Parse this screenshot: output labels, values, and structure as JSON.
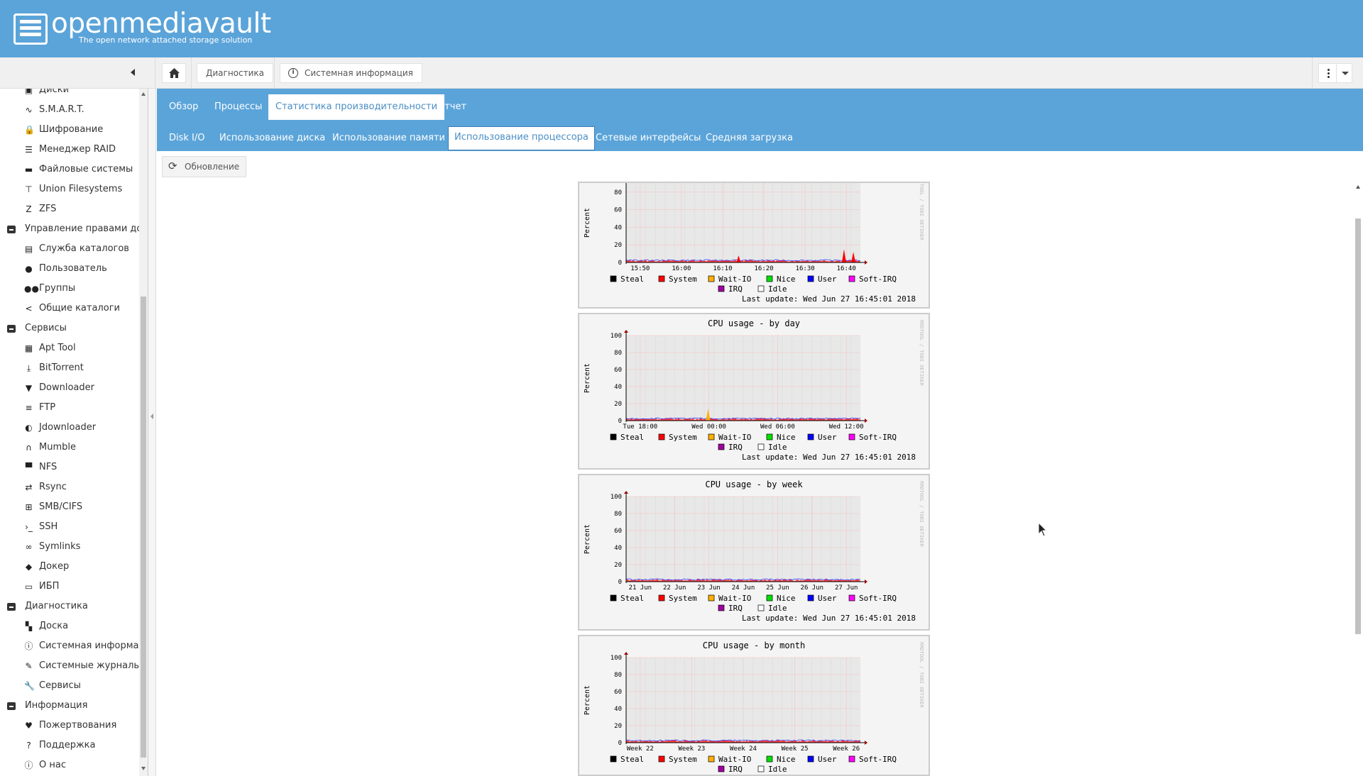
{
  "header": {
    "brand": "openmediavault",
    "tagline": "The open network attached storage solution"
  },
  "toolbar": {
    "breadcrumb": [
      "Диагностика",
      "Системная информация"
    ]
  },
  "sidebar": {
    "items": [
      {
        "type": "item",
        "icon": "disk-icon",
        "glyph": "▣",
        "label": "Диски"
      },
      {
        "type": "item",
        "icon": "heartbeat-icon",
        "glyph": "∿",
        "label": "S.M.A.R.T."
      },
      {
        "type": "item",
        "icon": "lock-icon",
        "glyph": "🔒",
        "label": "Шифрование"
      },
      {
        "type": "item",
        "icon": "database-icon",
        "glyph": "☰",
        "label": "Менеджер RAID"
      },
      {
        "type": "item",
        "icon": "folder-icon",
        "glyph": "▬",
        "label": "Файловые системы"
      },
      {
        "type": "item",
        "icon": "sitemap-icon",
        "glyph": "⊤",
        "label": "Union Filesystems"
      },
      {
        "type": "item",
        "icon": "zfs-icon",
        "glyph": "Z",
        "label": "ZFS"
      },
      {
        "type": "group",
        "label": "Управление правами доступа"
      },
      {
        "type": "item",
        "icon": "address-card-icon",
        "glyph": "▤",
        "label": "Служба каталогов"
      },
      {
        "type": "item",
        "icon": "user-icon",
        "glyph": "●",
        "label": "Пользователь"
      },
      {
        "type": "item",
        "icon": "users-icon",
        "glyph": "●●",
        "label": "Группы"
      },
      {
        "type": "item",
        "icon": "share-icon",
        "glyph": "<",
        "label": "Общие каталоги"
      },
      {
        "type": "group",
        "label": "Сервисы"
      },
      {
        "type": "item",
        "icon": "apt-icon",
        "glyph": "▦",
        "label": "Apt Tool"
      },
      {
        "type": "item",
        "icon": "download-tray-icon",
        "glyph": "⤓",
        "label": "BitTorrent"
      },
      {
        "type": "item",
        "icon": "download-box-icon",
        "glyph": "▼",
        "label": "Downloader"
      },
      {
        "type": "item",
        "icon": "server-icon",
        "glyph": "≡",
        "label": "FTP"
      },
      {
        "type": "item",
        "icon": "jdownloader-icon",
        "glyph": "◐",
        "label": "Jdownloader"
      },
      {
        "type": "item",
        "icon": "headphones-icon",
        "glyph": "∩",
        "label": "Mumble"
      },
      {
        "type": "item",
        "icon": "desktop-icon",
        "glyph": "▀",
        "label": "NFS"
      },
      {
        "type": "item",
        "icon": "rsync-icon",
        "glyph": "⇄",
        "label": "Rsync"
      },
      {
        "type": "item",
        "icon": "windows-icon",
        "glyph": "⊞",
        "label": "SMB/CIFS"
      },
      {
        "type": "item",
        "icon": "terminal-icon",
        "glyph": "›_",
        "label": "SSH"
      },
      {
        "type": "item",
        "icon": "link-icon",
        "glyph": "∞",
        "label": "Symlinks"
      },
      {
        "type": "item",
        "icon": "docker-icon",
        "glyph": "◆",
        "label": "Докер"
      },
      {
        "type": "item",
        "icon": "ups-icon",
        "glyph": "▭",
        "label": "ИБП"
      },
      {
        "type": "group",
        "label": "Диагностика"
      },
      {
        "type": "item",
        "icon": "dashboard-icon",
        "glyph": "▚",
        "label": "Доска"
      },
      {
        "type": "item",
        "icon": "info-circle-icon",
        "glyph": "ⓘ",
        "label": "Системная информация"
      },
      {
        "type": "item",
        "icon": "edit-icon",
        "glyph": "✎",
        "label": "Системные журналы"
      },
      {
        "type": "item",
        "icon": "wrench-icon",
        "glyph": "🔧",
        "label": "Сервисы"
      },
      {
        "type": "group",
        "label": "Информация"
      },
      {
        "type": "item",
        "icon": "heart-icon",
        "glyph": "♥",
        "label": "Пожертвования"
      },
      {
        "type": "item",
        "icon": "question-circle-icon",
        "glyph": "?",
        "label": "Поддержка"
      },
      {
        "type": "item",
        "icon": "info-icon",
        "glyph": "ⓘ",
        "label": "О нас"
      }
    ]
  },
  "tabs": [
    "Обзор",
    "Процессы",
    "Статистика производительности",
    "Отчет"
  ],
  "subtabs": [
    "Disk I/O",
    "Использование диска",
    "Использование памяти",
    "Использование процессора",
    "Сетевые интерфейсы",
    "Средняя загрузка"
  ],
  "refresh_label": "Обновление",
  "colors": {
    "header": "#5ba4d9",
    "accent": "#4a8ec4"
  },
  "rrd": {
    "ylabel": "Percent",
    "watermark": "RRDTOOL / TOBI OETIKER",
    "last_update": "Last update: Wed Jun 27 16:45:01 2018",
    "legend": [
      {
        "name": "Steal",
        "color": "#000000"
      },
      {
        "name": "System",
        "color": "#ff0000"
      },
      {
        "name": "Wait-IO",
        "color": "#ffb000"
      },
      {
        "name": "Nice",
        "color": "#00e000"
      },
      {
        "name": "User",
        "color": "#0000ff"
      },
      {
        "name": "Soft-IRQ",
        "color": "#ff00ff"
      },
      {
        "name": "IRQ",
        "color": "#a000a0"
      },
      {
        "name": "Idle",
        "color": "#ffffff"
      }
    ]
  },
  "chart_data": [
    {
      "type": "area",
      "title": "",
      "ylabel": "Percent",
      "ylim": [
        0,
        100
      ],
      "x_ticks": [
        "15:50",
        "16:00",
        "16:10",
        "16:20",
        "16:30",
        "16:40"
      ],
      "y_ticks": [
        0,
        20,
        40,
        60,
        80
      ],
      "spikes": [
        {
          "at": 0.93,
          "value": 15
        },
        {
          "at": 0.48,
          "value": 8
        },
        {
          "at": 0.97,
          "value": 12
        }
      ]
    },
    {
      "type": "area",
      "title": "CPU usage - by day",
      "ylabel": "Percent",
      "ylim": [
        0,
        100
      ],
      "x_ticks": [
        "Tue 18:00",
        "Wed 00:00",
        "Wed 06:00",
        "Wed 12:00"
      ],
      "y_ticks": [
        0,
        20,
        40,
        60,
        80,
        100
      ],
      "spikes": [
        {
          "at": 0.35,
          "value": 14
        }
      ]
    },
    {
      "type": "area",
      "title": "CPU usage - by week",
      "ylabel": "Percent",
      "ylim": [
        0,
        100
      ],
      "x_ticks": [
        "21 Jun",
        "22 Jun",
        "23 Jun",
        "24 Jun",
        "25 Jun",
        "26 Jun",
        "27 Jun"
      ],
      "y_ticks": [
        0,
        20,
        40,
        60,
        80,
        100
      ],
      "spikes": []
    },
    {
      "type": "area",
      "title": "CPU usage - by month",
      "ylabel": "Percent",
      "ylim": [
        0,
        100
      ],
      "x_ticks": [
        "Week 22",
        "Week 23",
        "Week 24",
        "Week 25",
        "Week 26"
      ],
      "y_ticks": [
        0,
        20,
        40,
        60,
        80,
        100
      ],
      "spikes": []
    }
  ]
}
